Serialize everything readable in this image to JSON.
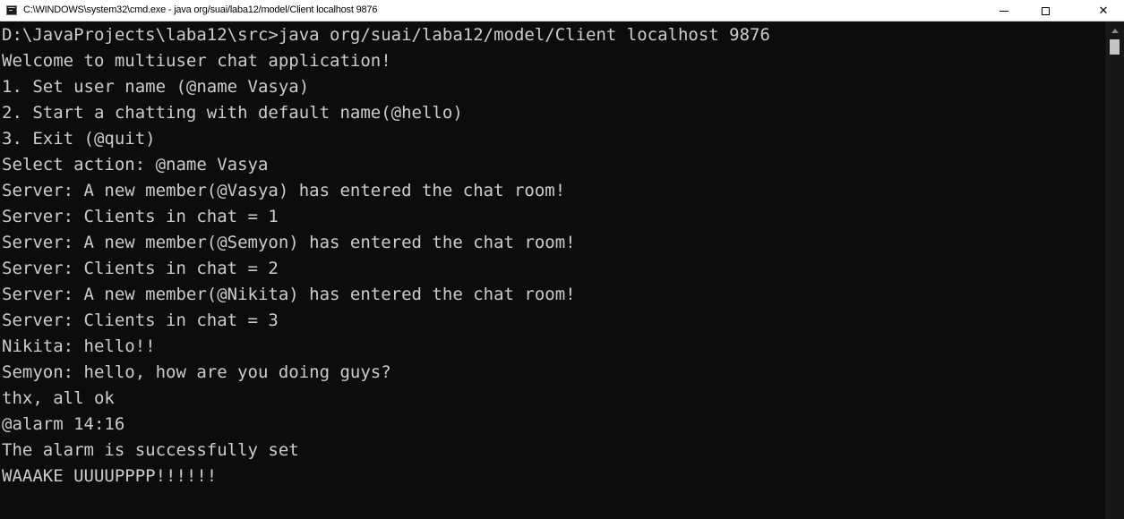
{
  "window": {
    "title": "C:\\WINDOWS\\system32\\cmd.exe - java  org/suai/laba12/model/Client localhost 9876",
    "icons": {
      "app": "cmd-icon",
      "minimize": "minimize-icon",
      "maximize": "maximize-icon",
      "close": "close-icon"
    },
    "close_glyph": "✕"
  },
  "console": {
    "background": "#0c0c0c",
    "foreground": "#cccccc",
    "lines": [
      "D:\\JavaProjects\\laba12\\src>java org/suai/laba12/model/Client localhost 9876",
      "Welcome to multiuser chat application!",
      "1. Set user name (@name Vasya)",
      "2. Start a chatting with default name(@hello)",
      "3. Exit (@quit)",
      "Select action: @name Vasya",
      "Server: A new member(@Vasya) has entered the chat room!",
      "Server: Clients in chat = 1",
      "Server: A new member(@Semyon) has entered the chat room!",
      "Server: Clients in chat = 2",
      "Server: A new member(@Nikita) has entered the chat room!",
      "Server: Clients in chat = 3",
      "Nikita: hello!!",
      "Semyon: hello, how are you doing guys?",
      "thx, all ok",
      "@alarm 14:16",
      "The alarm is successfully set",
      "WAAAKE UUUUPPPP!!!!!!"
    ]
  }
}
